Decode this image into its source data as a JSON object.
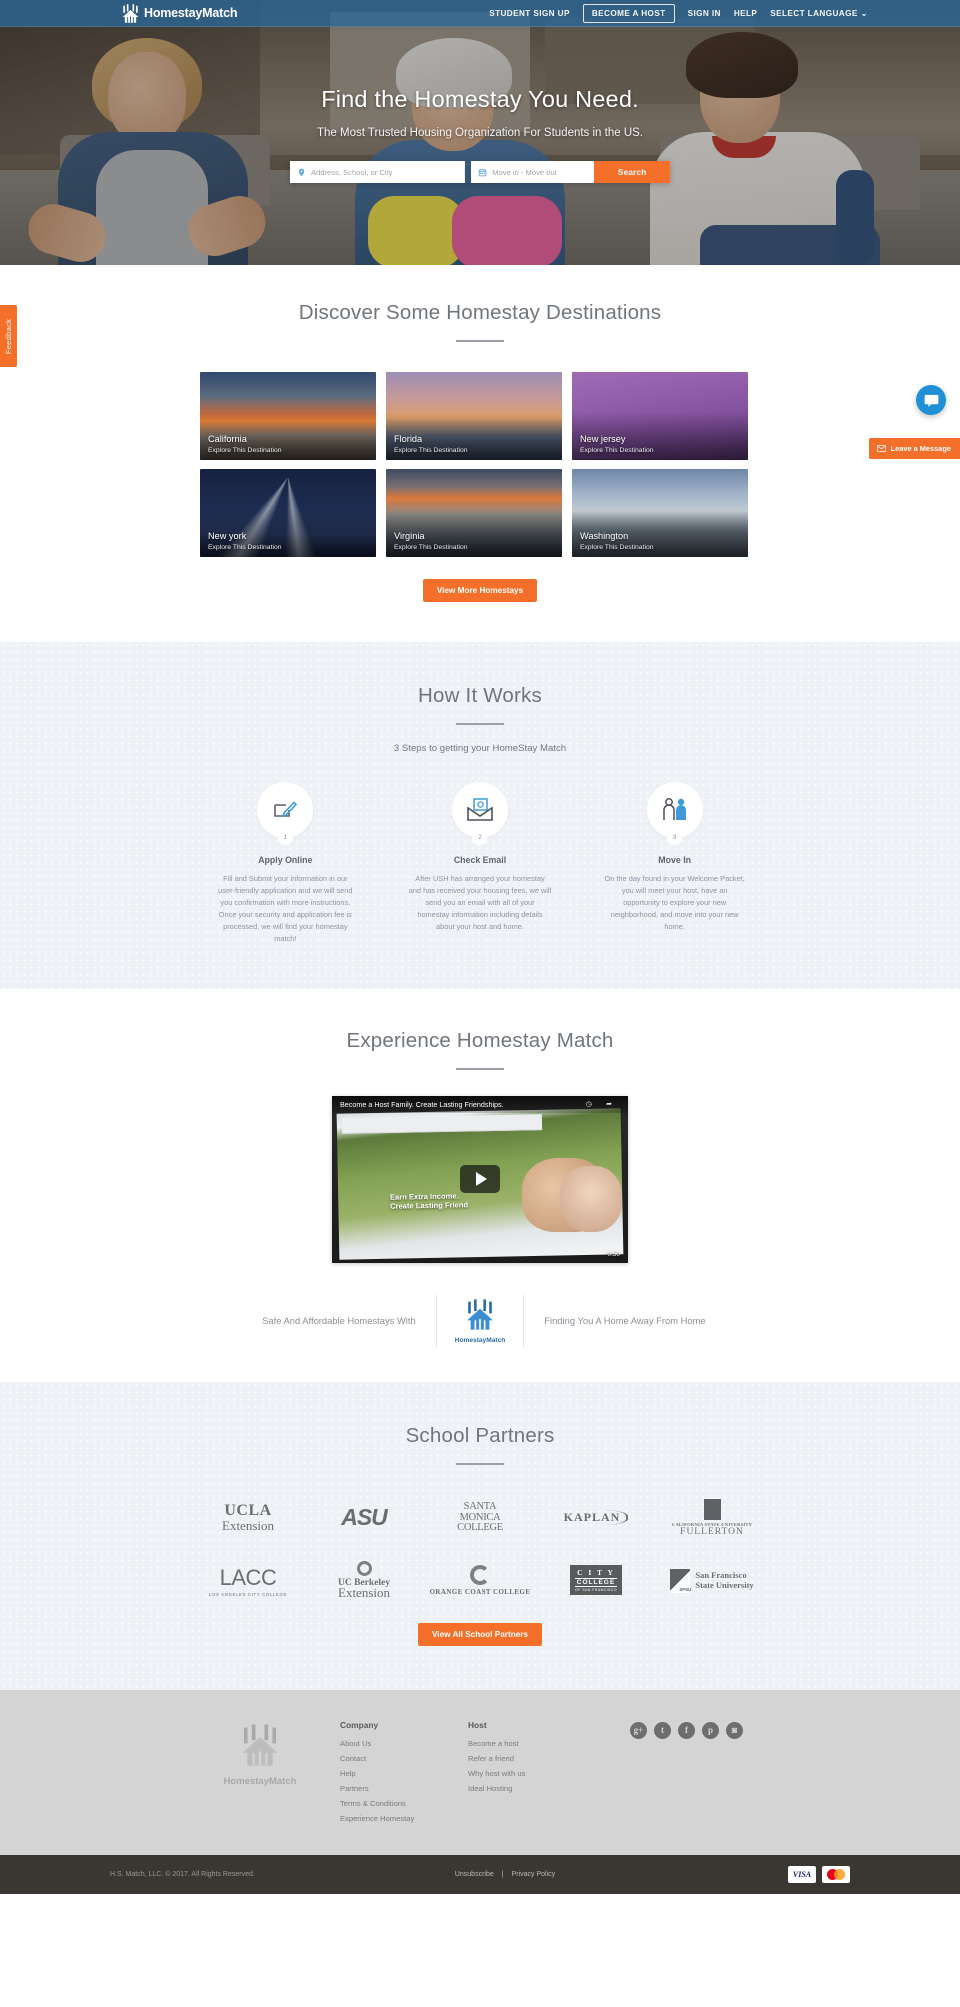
{
  "header": {
    "brand": "HomestayMatch",
    "nav": [
      {
        "label": "STUDENT SIGN UP",
        "style": "plain"
      },
      {
        "label": "BECOME A HOST",
        "style": "boxed"
      },
      {
        "label": "SIGN IN",
        "style": "plain"
      },
      {
        "label": "HELP",
        "style": "plain"
      },
      {
        "label": "SELECT LANGUAGE",
        "style": "plain-caret"
      }
    ]
  },
  "hero": {
    "title": "Find the Homestay You Need.",
    "subtitle": "The Most Trusted Housing Organization For Students in the US.",
    "search": {
      "location_placeholder": "Address, School, or City",
      "date_placeholder": "Move in - Move out",
      "button": "Search"
    }
  },
  "widgets": {
    "feedback": "Feedback",
    "chat_icon": "chat-icon",
    "leave_message": "Leave a Message"
  },
  "destinations": {
    "title": "Discover Some Homestay Destinations",
    "cta_label": "Explore This Destination",
    "items": [
      {
        "name": "California",
        "cta": "Explore This Destination",
        "img": "img-california"
      },
      {
        "name": "Florida",
        "cta": "Explore This Destination",
        "img": "img-florida"
      },
      {
        "name": "New jersey",
        "cta": "Explore This Destination",
        "img": "img-newjersey"
      },
      {
        "name": "New york",
        "cta": "Explore This Destination",
        "img": "img-newyork"
      },
      {
        "name": "Virginia",
        "cta": "Explore This Destination",
        "img": "img-virginia"
      },
      {
        "name": "Washington",
        "cta": "Explore This Destination",
        "img": "img-washington"
      }
    ],
    "button": "View More Homestays"
  },
  "how_it_works": {
    "title": "How It Works",
    "subtitle": "3 Steps to getting your HomeStay Match",
    "steps": [
      {
        "number": "1",
        "icon": "pencil-edit-icon",
        "heading": "Apply Online",
        "body": "Fill and Submit your information in our user-friendly application and we will send you confirmation with more instructions. Once your security and application fee is processed, we will find your homestay match!"
      },
      {
        "number": "2",
        "icon": "email-envelope-icon",
        "heading": "Check Email",
        "body": "After USH has arranged your homestay and has received your housing fees, we will send you an email with all of your homestay information including details about your host and home."
      },
      {
        "number": "3",
        "icon": "people-icon",
        "heading": "Move In",
        "body": "On the day found in your Welcome Packet, you will meet your host, have an opportunity to explore your new neighborhood, and move into your new home."
      }
    ]
  },
  "experience": {
    "title": "Experience Homestay Match",
    "video": {
      "title": "Become a Host Family. Create Lasting Friendships.",
      "overlay_line1": "Earn Extra Income.",
      "overlay_line2": "Create Lasting Friend",
      "duration": "0:50",
      "play_icon": "play-icon",
      "clock_icon": "watch-later-icon",
      "share_icon": "share-icon"
    },
    "tagline_left": "Safe And Affordable Homestays With",
    "tagline_logo": "HomestayMatch",
    "tagline_right": "Finding You A Home Away From Home"
  },
  "partners": {
    "title": "School Partners",
    "logos": [
      {
        "key": "ucla",
        "l1": "UCLA",
        "l2": "Extension"
      },
      {
        "key": "asu",
        "l1": "ASU"
      },
      {
        "key": "smc",
        "l1": "SANTA",
        "l2": "MONICA",
        "l3": "COLLEGE"
      },
      {
        "key": "kaplan",
        "l1": "KAPLAN"
      },
      {
        "key": "csuf",
        "l1": "CALIFORNIA STATE UNIVERSITY",
        "l2": "FULLERTON"
      },
      {
        "key": "lacc",
        "l1": "LACC",
        "l2": "LOS ANGELES CITY COLLEGE"
      },
      {
        "key": "ucb",
        "l1": "UC Berkeley",
        "l2": "Extension"
      },
      {
        "key": "occ",
        "l1": "ORANGE COAST COLLEGE"
      },
      {
        "key": "ccsf",
        "l1": "C I T Y",
        "l2": "COLLEGE",
        "l3": "OF SAN FRANCISCO"
      },
      {
        "key": "sfsu",
        "l1": "San Francisco",
        "l2": "State University"
      }
    ],
    "button": "View All School Partners"
  },
  "footer": {
    "brand": "HomestayMatch",
    "columns": [
      {
        "heading": "Company",
        "links": [
          "About Us",
          "Contact",
          "Help",
          "Partners",
          "Terms & Conditions",
          "Experience Homestay"
        ]
      },
      {
        "heading": "Host",
        "links": [
          "Become a host",
          "Refer a friend",
          "Why host with us",
          "Ideal Hosting"
        ]
      }
    ],
    "social": [
      {
        "name": "google-plus-icon",
        "glyph": "g+"
      },
      {
        "name": "twitter-icon",
        "glyph": "t"
      },
      {
        "name": "facebook-icon",
        "glyph": "f"
      },
      {
        "name": "pinterest-icon",
        "glyph": "p"
      },
      {
        "name": "instagram-icon",
        "glyph": "◙"
      }
    ],
    "copyright": "H.S. Match, LLC. © 2017. All Rights Reserved.",
    "legal": [
      {
        "label": "Unsubscribe"
      },
      {
        "label": "Privacy Policy"
      }
    ],
    "separator": "|",
    "cards": [
      {
        "name": "visa-card",
        "label": "VISA"
      },
      {
        "name": "mastercard-card",
        "label": ""
      }
    ]
  },
  "colors": {
    "accent_orange": "#f4702a",
    "header_blue": "#2a6898",
    "brand_blue": "#2b6ea8",
    "section_grey": "#eef2f6",
    "footer_grey": "#d4d4d4",
    "copybar_dark": "#3a3733"
  }
}
